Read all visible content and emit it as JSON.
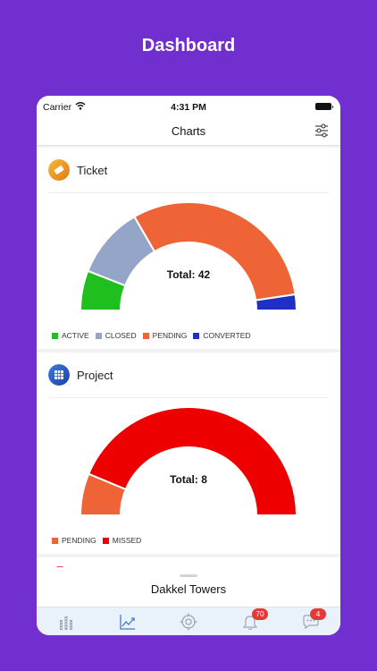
{
  "promo_title": "Dashboard",
  "status_bar": {
    "carrier": "Carrier",
    "time": "4:31 PM"
  },
  "nav": {
    "title": "Charts",
    "filter_icon": "sliders-icon"
  },
  "ticket": {
    "title": "Ticket",
    "total_label": "Total: 42",
    "legend": [
      "ACTIVE",
      "CLOSED",
      "PENDING",
      "CONVERTED"
    ],
    "colors": {
      "active": "#1fbf1f",
      "closed": "#94a5c7",
      "pending": "#ef6436",
      "converted": "#2130c4"
    }
  },
  "project": {
    "title": "Project",
    "total_label": "Total: 8",
    "legend": [
      "PENDING",
      "MISSED"
    ],
    "colors": {
      "pending": "#ef6436",
      "missed": "#ee0000"
    }
  },
  "sheet": {
    "title": "Dakkel Towers"
  },
  "tab_bar": {
    "items": [
      "buildings-icon",
      "analytics-icon",
      "target-icon",
      "bell-icon",
      "chat-icon"
    ],
    "notifications_badge": "70",
    "messages_badge": "4"
  },
  "chart_data": [
    {
      "type": "pie",
      "title": "Ticket",
      "categories": [
        "ACTIVE",
        "CLOSED",
        "PENDING",
        "CONVERTED"
      ],
      "values": [
        5,
        9,
        26,
        2
      ],
      "total": 42,
      "legend_position": "bottom-left"
    },
    {
      "type": "pie",
      "title": "Project",
      "categories": [
        "PENDING",
        "MISSED"
      ],
      "values": [
        1,
        7
      ],
      "total": 8,
      "legend_position": "bottom-left"
    }
  ]
}
